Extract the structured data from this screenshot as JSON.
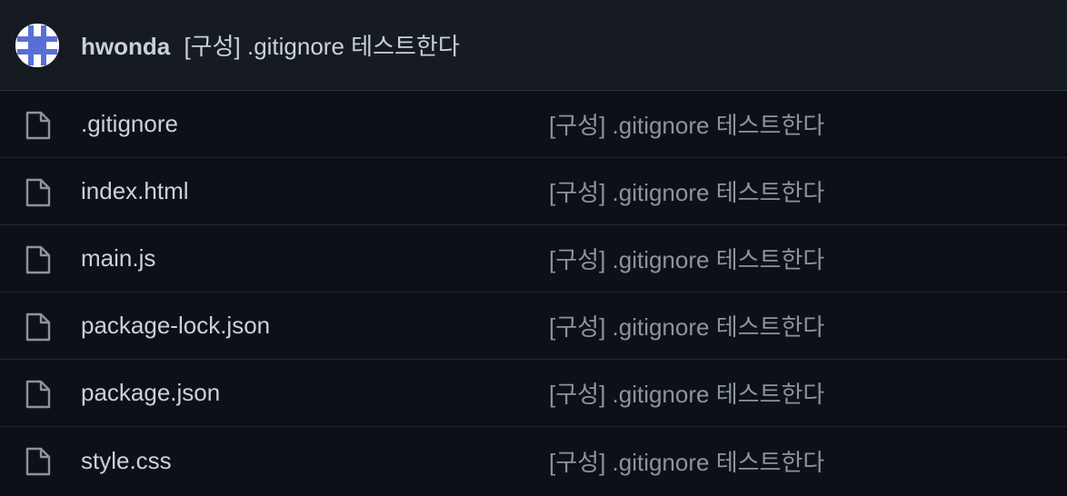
{
  "latest_commit": {
    "author": "hwonda",
    "message": "[구성] .gitignore 테스트한다"
  },
  "files": [
    {
      "name": ".gitignore",
      "commit": "[구성] .gitignore 테스트한다"
    },
    {
      "name": "index.html",
      "commit": "[구성] .gitignore 테스트한다"
    },
    {
      "name": "main.js",
      "commit": "[구성] .gitignore 테스트한다"
    },
    {
      "name": "package-lock.json",
      "commit": "[구성] .gitignore 테스트한다"
    },
    {
      "name": "package.json",
      "commit": "[구성] .gitignore 테스트한다"
    },
    {
      "name": "style.css",
      "commit": "[구성] .gitignore 테스트한다"
    }
  ],
  "icons": {
    "avatar": "identicon-avatar",
    "file": "file-icon"
  },
  "colors": {
    "background": "#0d1117",
    "header_background": "#161b22",
    "text": "#c9d1d9",
    "muted_text": "#8b949e",
    "border": "#30363d",
    "identicon": "#5a6fd6"
  }
}
